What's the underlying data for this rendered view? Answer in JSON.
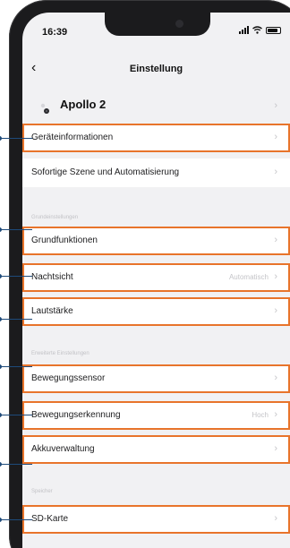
{
  "status": {
    "time": "16:39",
    "signal_icon": "signal-bars-icon",
    "wifi_icon": "wifi-icon",
    "battery_icon": "battery-icon"
  },
  "nav": {
    "back_icon": "chevron-left-icon",
    "title": "Einstellung"
  },
  "device": {
    "name": "Apollo 2",
    "icon": "camera-device-icon"
  },
  "accent": "#e8742b",
  "callout_color": "#1e4a7a",
  "sections": {
    "basic": "Grundeinstellungen",
    "advanced": "Erweiterte Einstellungen",
    "storage": "Speicher"
  },
  "rows": {
    "device_info": {
      "label": "Geräteinformationen"
    },
    "scene": {
      "label": "Sofortige Szene und Automatisierung"
    },
    "basic_functions": {
      "label": "Grundfunktionen"
    },
    "night_vision": {
      "label": "Nachtsicht",
      "value": "Automatisch"
    },
    "volume": {
      "label": "Lautstärke"
    },
    "motion_sensor": {
      "label": "Bewegungssensor"
    },
    "motion_detection": {
      "label": "Bewegungserkennung",
      "value": "Hoch"
    },
    "battery_mgmt": {
      "label": "Akkuverwaltung"
    },
    "sd_card": {
      "label": "SD-Karte"
    }
  },
  "chevron_glyph": "›",
  "back_glyph": "‹"
}
